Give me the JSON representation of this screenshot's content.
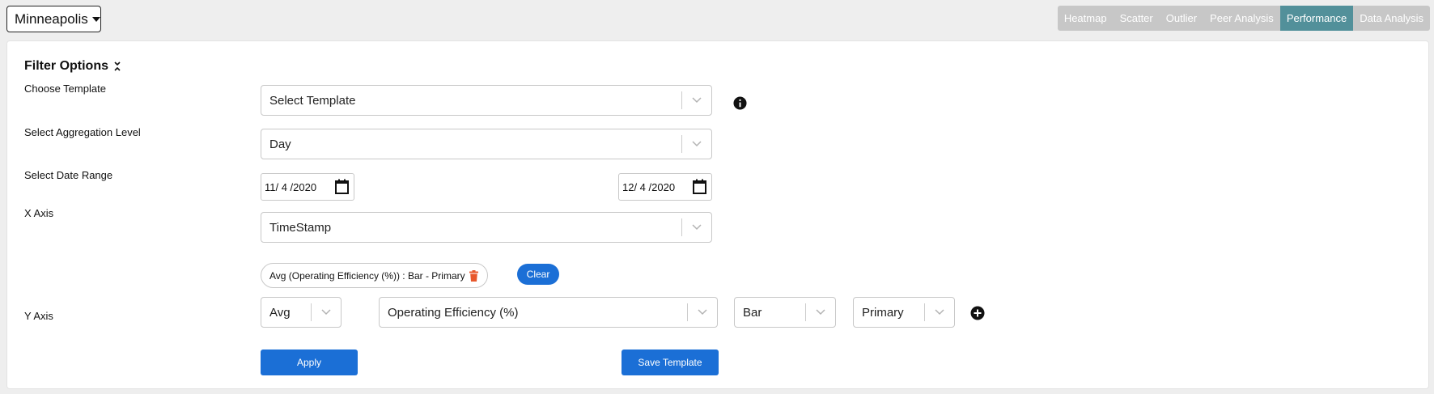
{
  "location": {
    "selected": "Minneapolis"
  },
  "nav": {
    "tabs": [
      {
        "label": "Heatmap"
      },
      {
        "label": "Scatter"
      },
      {
        "label": "Outlier"
      },
      {
        "label": "Peer Analysis"
      },
      {
        "label": "Performance",
        "active": true
      },
      {
        "label": "Data Analysis"
      }
    ],
    "colors": {
      "tab_bg": "#c7c7c7",
      "active_bg": "#52909a"
    }
  },
  "filter": {
    "title": "Filter Options",
    "template": {
      "label": "Choose Template",
      "value": "Select Template"
    },
    "aggregation": {
      "label": "Select Aggregation Level",
      "value": "Day"
    },
    "date_range": {
      "label": "Select Date Range",
      "start": "11/ 4 /2020",
      "end": "12/ 4 /2020"
    },
    "x_axis": {
      "label": "X Axis",
      "value": "TimeStamp"
    },
    "y_axis": {
      "label": "Y Axis",
      "chip": "Avg (Operating Efficiency (%)) : Bar - Primary",
      "clear_label": "Clear",
      "function": "Avg",
      "metric": "Operating Efficiency (%)",
      "chart_type": "Bar",
      "axis_side": "Primary"
    },
    "apply_label": "Apply",
    "save_label": "Save Template"
  },
  "colors": {
    "primary": "#1b6fd6",
    "delete": "#e8582c"
  }
}
